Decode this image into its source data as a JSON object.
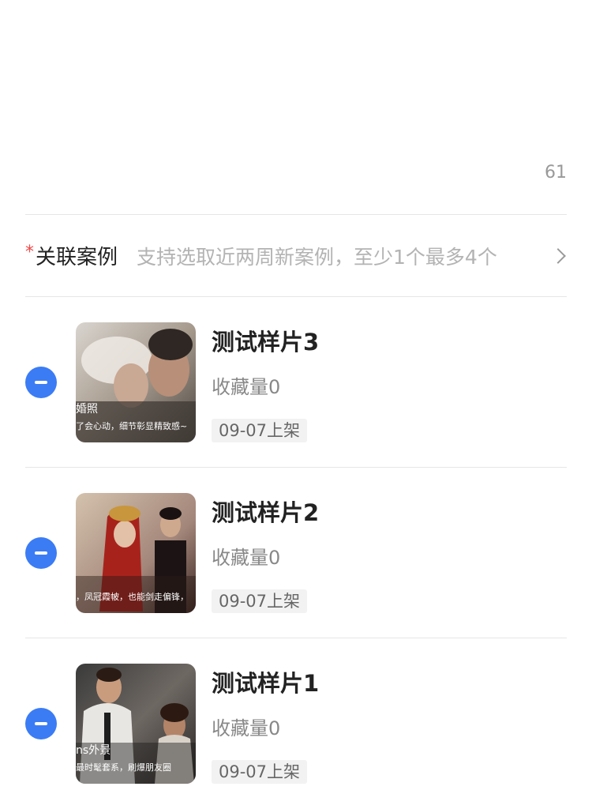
{
  "description_counter": "61",
  "related_cases": {
    "required_mark": "*",
    "label": "关联案例",
    "hint": "支持选取近两周新案例，至少1个最多4个"
  },
  "cases": [
    {
      "title": "测试样片3",
      "favorites": "收藏量0",
      "tag": "09-07上架",
      "thumb_caption_1": "婚照",
      "thumb_caption_2": "了会心动，细节彰显精致感~"
    },
    {
      "title": "测试样片2",
      "favorites": "收藏量0",
      "tag": "09-07上架",
      "thumb_caption_1": "",
      "thumb_caption_2": "，凤冠霞帔，也能剑走偏锋，"
    },
    {
      "title": "测试样片1",
      "favorites": "收藏量0",
      "tag": "09-07上架",
      "thumb_caption_1": "ns外景",
      "thumb_caption_2": "最时髦套系，刷爆朋友圈"
    }
  ]
}
